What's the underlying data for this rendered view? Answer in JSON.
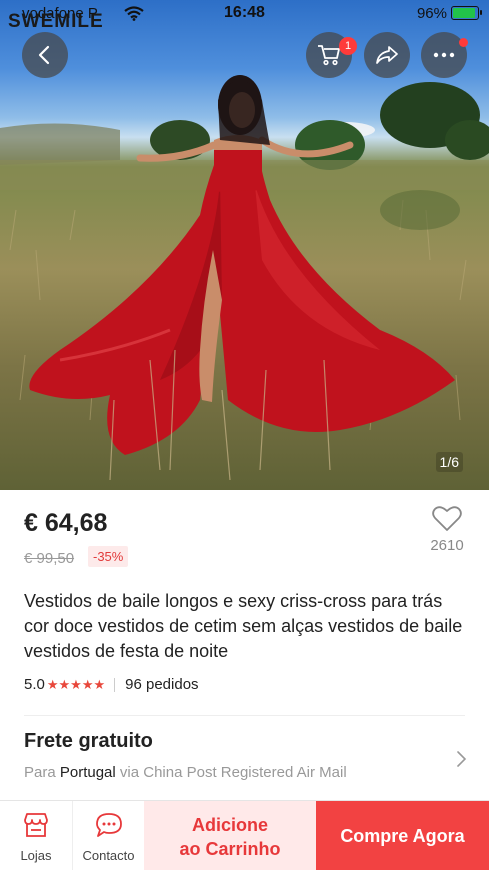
{
  "status_bar": {
    "carrier": "vodafone P",
    "watermark": "SWEMILE",
    "time": "16:48",
    "battery": "96%"
  },
  "header": {
    "cart_badge": "1",
    "image_counter": "1/6"
  },
  "product": {
    "price": "€ 64,68",
    "original_price": "€ 99,50",
    "discount": "-35%",
    "wishlist_count": "2610",
    "title": "Vestidos de baile longos e sexy criss-cross para trás cor doce vestidos de cetim sem alças vestidos de baile vestidos de festa de noite",
    "rating": "5.0",
    "stars": "★★★★★",
    "orders": "96 pedidos"
  },
  "shipping": {
    "title": "Frete gratuito",
    "to_prefix": "Para",
    "country": "Portugal",
    "via": "via China Post Registered Air Mail"
  },
  "bottom_bar": {
    "store_label": "Lojas",
    "contact_label": "Contacto",
    "add_to_cart_line1": "Adicione",
    "add_to_cart_line2": "ao Carrinho",
    "buy_now": "Compre Agora"
  },
  "colors": {
    "accent": "#f24242",
    "accent_light": "#ffe9e9",
    "dress": "#c0121d"
  },
  "icons": {
    "back": "chevron-left-icon",
    "cart": "cart-icon",
    "share": "share-icon",
    "more": "more-dots-icon",
    "wishlist": "heart-icon",
    "store": "store-icon",
    "contact": "chat-icon"
  }
}
